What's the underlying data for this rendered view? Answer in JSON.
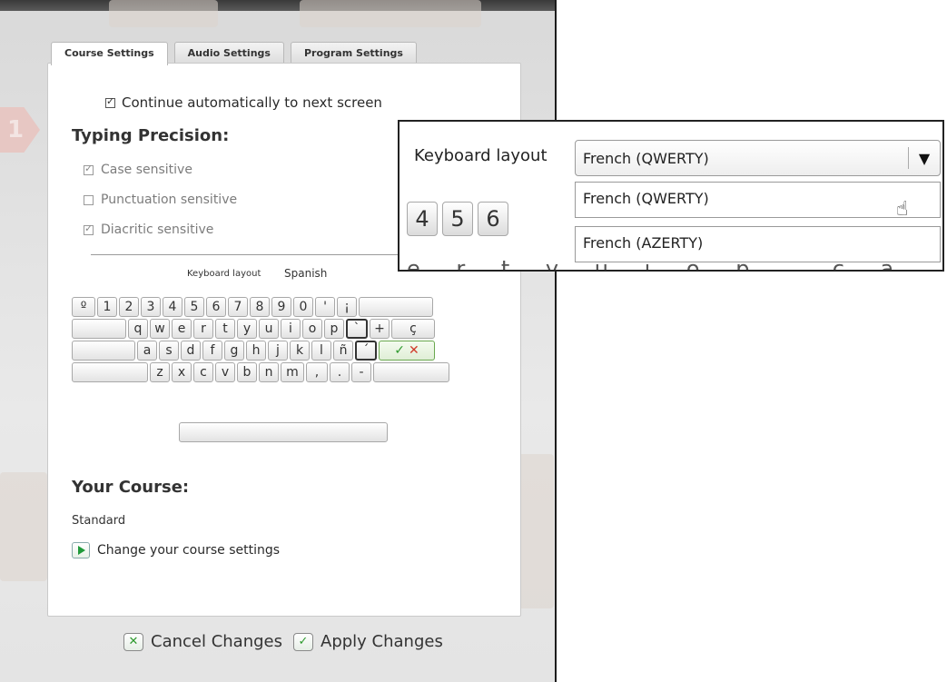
{
  "tabs": [
    {
      "label": "Course Settings",
      "active": true
    },
    {
      "label": "Audio Settings",
      "active": false
    },
    {
      "label": "Program Settings",
      "active": false
    }
  ],
  "settings": {
    "continue_label": "Continue automatically to next screen",
    "continue_checked": true,
    "typing_precision_title": "Typing Precision:",
    "options": [
      {
        "label": "Case sensitive",
        "checked": true
      },
      {
        "label": "Punctuation sensitive",
        "checked": false
      },
      {
        "label": "Diacritic sensitive",
        "checked": true
      }
    ],
    "keyboard_layout_label": "Keyboard layout",
    "keyboard_layout_value": "Spanish"
  },
  "keyboard": {
    "row1": [
      "º",
      "1",
      "2",
      "3",
      "4",
      "5",
      "6",
      "7",
      "8",
      "9",
      "0",
      "'",
      "¡",
      ""
    ],
    "row2": [
      "",
      "q",
      "w",
      "e",
      "r",
      "t",
      "y",
      "u",
      "i",
      "o",
      "p",
      "`",
      "+",
      "ç"
    ],
    "row3": [
      "",
      "a",
      "s",
      "d",
      "f",
      "g",
      "h",
      "j",
      "k",
      "l",
      "ñ",
      "´"
    ],
    "row4": [
      "",
      "z",
      "x",
      "c",
      "v",
      "b",
      "n",
      "m",
      ",",
      ".",
      "-",
      ""
    ],
    "enter_check": "✓",
    "enter_x": "✕"
  },
  "course": {
    "title": "Your Course:",
    "value": "Standard",
    "change_label": "Change your course settings"
  },
  "footer": {
    "cancel_label": "Cancel Changes",
    "apply_label": "Apply Changes"
  },
  "callout": {
    "label": "Keyboard layout",
    "selected": "French (QWERTY)",
    "arrow": "▼",
    "options": [
      "French (QWERTY)",
      "French (AZERTY)"
    ],
    "peek_keys": [
      "4",
      "5",
      "6"
    ],
    "peek_row2": "e r t y u i o p ` ç a"
  },
  "colors": {
    "accent_green": "#2e9a2e",
    "cancel_red": "#d03a2a"
  }
}
